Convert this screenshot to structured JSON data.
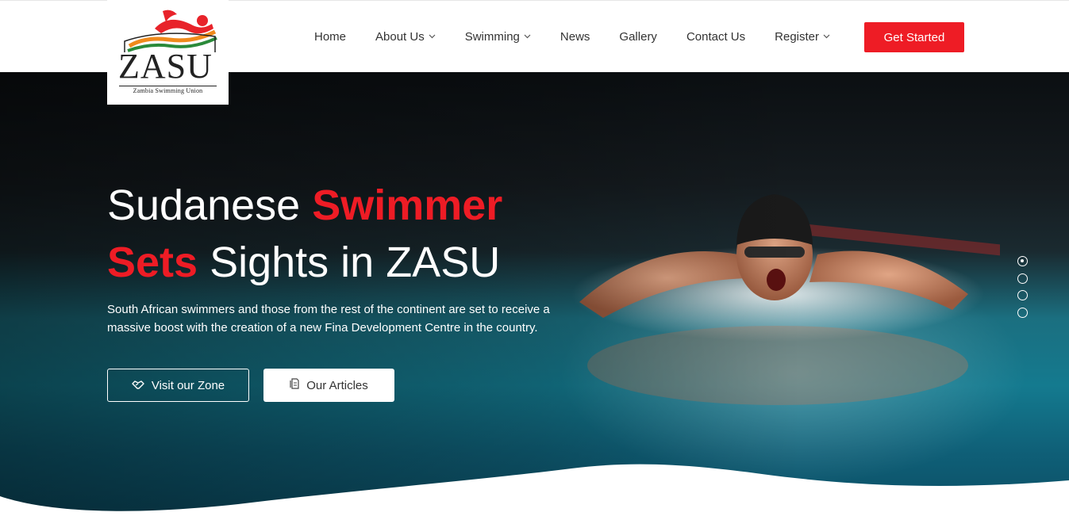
{
  "logo": {
    "text": "ZASU",
    "subtitle": "Zambia Swimming Union",
    "colors": {
      "red": "#e8232a",
      "green": "#2a8a3a",
      "orange": "#f08a1c",
      "dark": "#222222"
    }
  },
  "nav": {
    "items": [
      {
        "label": "Home",
        "has_dropdown": false
      },
      {
        "label": "About Us",
        "has_dropdown": true
      },
      {
        "label": "Swimming",
        "has_dropdown": true
      },
      {
        "label": "News",
        "has_dropdown": false
      },
      {
        "label": "Gallery",
        "has_dropdown": false
      },
      {
        "label": "Contact Us",
        "has_dropdown": false
      },
      {
        "label": "Register",
        "has_dropdown": true
      }
    ],
    "dropdown_icon": "chevron-down-icon",
    "cta_label": "Get Started"
  },
  "hero": {
    "headline_part1": "Sudanese ",
    "headline_highlight1": "Swimmer",
    "headline_highlight2": "Sets",
    "headline_part2": " Sights in ZASU",
    "lead": "South African swimmers and those from the rest of the continent are set to receive a massive boost with the creation of a new Fina Development Centre in the country.",
    "primary_button": {
      "label": "Visit our Zone",
      "icon": "handshake-icon"
    },
    "secondary_button": {
      "label": "Our Articles",
      "icon": "document-icon"
    },
    "slider": {
      "count": 4,
      "active_index": 0
    }
  },
  "colors": {
    "accent": "#ee1c25",
    "nav_text": "#333333",
    "hero_text": "#ffffff"
  }
}
